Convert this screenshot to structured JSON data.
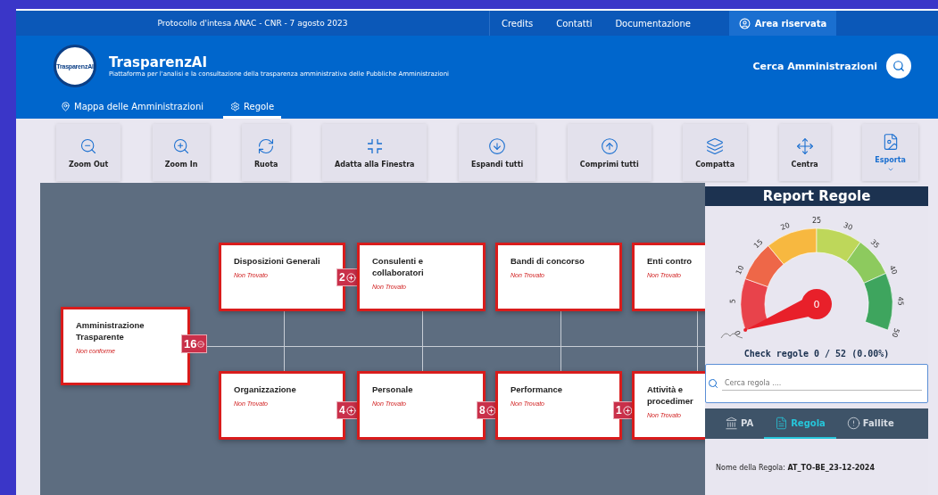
{
  "topbar": {
    "agreement": "Protocollo d'intesa ANAC - CNR - 7 agosto 2023",
    "links": [
      "Credits",
      "Contatti",
      "Documentazione"
    ],
    "reserved": "Area riservata"
  },
  "header": {
    "logo_text": "TrasparenzAI",
    "title": "TrasparenzAI",
    "subtitle": "Piattaforma per l'analisi e la consultazione della trasparenza amministrativa delle Pubbliche Amministrazioni",
    "search_label": "Cerca Amministrazioni"
  },
  "nav": [
    {
      "label": "Mappa delle Amministrazioni",
      "selected": false
    },
    {
      "label": "Regole",
      "selected": true
    }
  ],
  "toolbar": [
    {
      "label": "Zoom Out",
      "kind": "action"
    },
    {
      "label": "Zoom In",
      "kind": "action"
    },
    {
      "label": "Ruota",
      "kind": "action"
    },
    {
      "label": "Adatta alla Finestra",
      "kind": "action"
    },
    {
      "label": "Espandi tutti",
      "kind": "action"
    },
    {
      "label": "Comprimi tutti",
      "kind": "action"
    },
    {
      "label": "Compatta",
      "kind": "action"
    },
    {
      "label": "Centra",
      "kind": "action"
    },
    {
      "label": "Esporta",
      "kind": "menu"
    }
  ],
  "tree": {
    "title": "Amministrazione Trasparente",
    "status": "Non conforme",
    "count": "16",
    "expanded": true,
    "children": [
      {
        "title": "Disposizioni Generali",
        "status": "Non Trovato",
        "count": "2",
        "expanded": false
      },
      {
        "title": "Consulenti e collaboratori",
        "status": "Non Trovato"
      },
      {
        "title": "Bandi di concorso",
        "status": "Non Trovato"
      },
      {
        "title": "Enti contro",
        "status": "Non Trovato"
      },
      {
        "title": "Organizzazione",
        "status": "Non Trovato",
        "count": "4",
        "expanded": false
      },
      {
        "title": "Personale",
        "status": "Non Trovato",
        "count": "8",
        "expanded": false
      },
      {
        "title": "Performance",
        "status": "Non Trovato",
        "count": "1",
        "expanded": false
      },
      {
        "title": "Attività e procedimer",
        "status": "Non Trovato"
      }
    ]
  },
  "report": {
    "title": "Report Regole",
    "gauge": {
      "ticks": [
        "0",
        "5",
        "10",
        "15",
        "20",
        "25",
        "30",
        "35",
        "40",
        "45",
        "50"
      ],
      "value": "0",
      "level": 0
    },
    "check": "Check regole 0 / 52 (0.00%)",
    "search": {
      "placeholder": "Cerca regola ...."
    },
    "tabs": [
      {
        "label": "PA",
        "selected": false
      },
      {
        "label": "Regola",
        "selected": true
      },
      {
        "label": "Fallite",
        "selected": false
      }
    ],
    "detail": "Nome della Regola: **AT_TO-BE_23-12-2024**"
  }
}
